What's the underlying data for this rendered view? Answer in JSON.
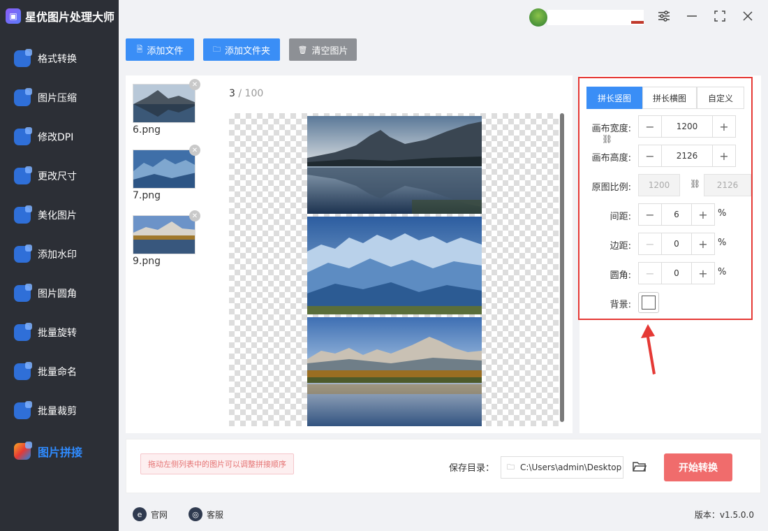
{
  "app": {
    "title": "星优图片处理大师"
  },
  "sidebar": {
    "items": [
      {
        "label": "格式转换",
        "icon": "format-convert-icon"
      },
      {
        "label": "图片压缩",
        "icon": "compress-icon"
      },
      {
        "label": "修改DPI",
        "icon": "dpi-icon"
      },
      {
        "label": "更改尺寸",
        "icon": "resize-icon"
      },
      {
        "label": "美化图片",
        "icon": "beautify-icon"
      },
      {
        "label": "添加水印",
        "icon": "watermark-icon"
      },
      {
        "label": "图片圆角",
        "icon": "round-corner-icon"
      },
      {
        "label": "批量旋转",
        "icon": "rotate-icon"
      },
      {
        "label": "批量命名",
        "icon": "rename-icon"
      },
      {
        "label": "批量裁剪",
        "icon": "crop-icon"
      },
      {
        "label": "图片拼接",
        "icon": "stitch-icon",
        "active": true
      }
    ]
  },
  "toolbar": {
    "add_file": "添加文件",
    "add_folder": "添加文件夹",
    "clear_images": "清空图片"
  },
  "files": [
    {
      "name": "6.png"
    },
    {
      "name": "7.png"
    },
    {
      "name": "9.png"
    }
  ],
  "preview": {
    "current": "3",
    "separator": "/",
    "total": "100"
  },
  "settings": {
    "tabs": [
      "拼长竖图",
      "拼长横图",
      "自定义"
    ],
    "active_tab": "拼长竖图",
    "canvas_width_label": "画布宽度:",
    "canvas_width": "1200",
    "canvas_height_label": "画布高度:",
    "canvas_height": "2126",
    "ratio_label": "原图比例:",
    "ratio_width": "1200",
    "ratio_height": "2126",
    "spacing_label": "间距:",
    "spacing": "6",
    "margin_label": "边距:",
    "margin": "0",
    "corner_label": "圆角:",
    "corner": "0",
    "percent": "%",
    "background_label": "背景:",
    "background_color": "#ffffff"
  },
  "bottom": {
    "hint": "拖动左侧列表中的图片可以调整拼接顺序",
    "save_label": "保存目录：",
    "save_path": "C:\\Users\\admin\\Desktop",
    "start_button": "开始转换"
  },
  "footer": {
    "website": "官网",
    "support": "客服",
    "version": "版本：v1.5.0.0"
  },
  "colors": {
    "accent": "#3a8ef6",
    "start_button": "#f06c6c",
    "highlight_frame": "#e53935"
  }
}
